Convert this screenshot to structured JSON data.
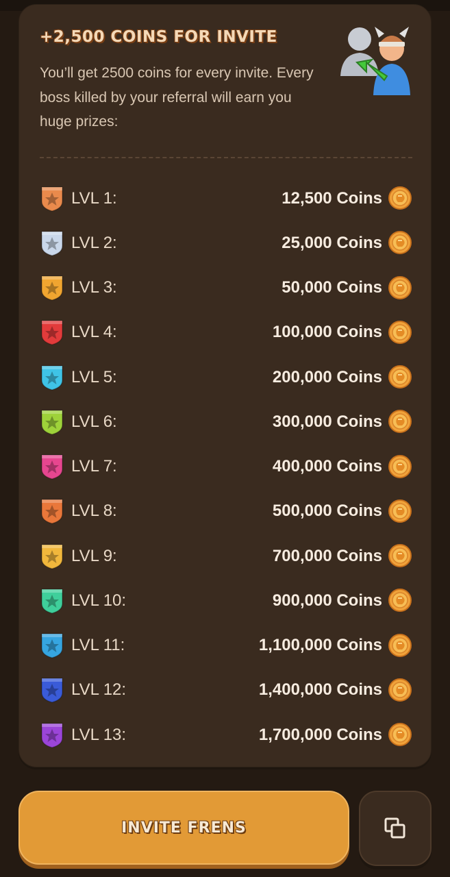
{
  "header": {
    "title": "+2,500 COINS FOR INVITE",
    "description": "You’ll get 2500 coins for every invite. Every boss killed by your referral will earn you huge prizes:",
    "illustration_icon": "referral-viking-icon"
  },
  "levels": [
    {
      "label": "LVL 1:",
      "reward": "12,500 Coins",
      "badge_color": "#e98a4c"
    },
    {
      "label": "LVL 2:",
      "reward": "25,000 Coins",
      "badge_color": "#c9d7ea"
    },
    {
      "label": "LVL 3:",
      "reward": "50,000 Coins",
      "badge_color": "#f0a530"
    },
    {
      "label": "LVL 4:",
      "reward": "100,000 Coins",
      "badge_color": "#e23b3b"
    },
    {
      "label": "LVL 5:",
      "reward": "200,000 Coins",
      "badge_color": "#3fc3e6"
    },
    {
      "label": "LVL 6:",
      "reward": "300,000 Coins",
      "badge_color": "#9ed23a"
    },
    {
      "label": "LVL 7:",
      "reward": "400,000 Coins",
      "badge_color": "#e6468f"
    },
    {
      "label": "LVL 8:",
      "reward": "500,000 Coins",
      "badge_color": "#e9773a"
    },
    {
      "label": "LVL 9:",
      "reward": "700,000 Coins",
      "badge_color": "#f1b73c"
    },
    {
      "label": "LVL 10:",
      "reward": "900,000 Coins",
      "badge_color": "#3fcf9b"
    },
    {
      "label": "LVL 11:",
      "reward": "1,100,000 Coins",
      "badge_color": "#36a5e0"
    },
    {
      "label": "LVL 12:",
      "reward": "1,400,000 Coins",
      "badge_color": "#3a5bd8"
    },
    {
      "label": "LVL 13:",
      "reward": "1,700,000 Coins",
      "badge_color": "#9b45d8"
    }
  ],
  "actions": {
    "invite_label": "INVITE FRENS",
    "copy_icon": "copy-icon"
  },
  "colors": {
    "background": "#241a12",
    "card": "#3a2b1f",
    "accent": "#e29a36",
    "coin": "#f0a23a"
  }
}
